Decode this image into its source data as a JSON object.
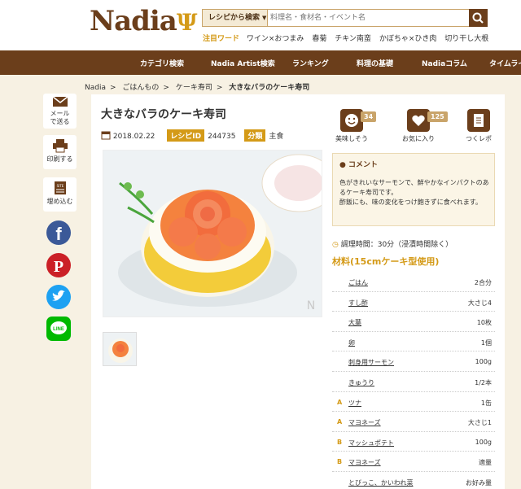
{
  "header": {
    "logo": "Nadia",
    "search_select": "レシピから検索",
    "search_placeholder": "料理名・食材名・イベント名",
    "hot_label": "注目ワード",
    "hot_words": [
      "ワイン×おつまみ",
      "春菊",
      "チキン南蛮",
      "かぼちゃ×ひき肉",
      "切り干し大根"
    ]
  },
  "nav": [
    "カテゴリ検索",
    "Nadia Artist検索",
    "ランキング",
    "料理の基礎",
    "Nadiaコラム",
    "タイムライ"
  ],
  "breadcrumb": [
    "Nadia",
    "ごはんもの",
    "ケーキ寿司",
    "大きなバラのケーキ寿司"
  ],
  "share": {
    "mail": "メール\nで送る",
    "print": "印刷する",
    "embed": "埋め込む",
    "colors": {
      "facebook": "#3b5998",
      "pinterest": "#cb2027",
      "twitter": "#1da1f2",
      "line": "#00b900"
    }
  },
  "recipe": {
    "title": "大きなバラのケーキ寿司",
    "date": "2018.02.22",
    "id_label": "レシピID",
    "id": "244735",
    "category_label": "分類",
    "category": "主食",
    "actions": [
      {
        "label": "美味しそう",
        "count": "34"
      },
      {
        "label": "お気に入り",
        "count": "125"
      },
      {
        "label": "つくレポ",
        "count": ""
      }
    ],
    "comment_title": "コメント",
    "comment": "色がきれいなサーモンで、鮮やかなインパクトのあるケーキ寿司です。\n酢飯にも、味の変化をつけ飽きずに食べれます。",
    "time": "調理時間：30分（浸漬時間除く）",
    "materials_title": "材料(15cmケーキ型使用)",
    "ingredients": [
      {
        "g": "",
        "name": "ごはん",
        "qty": "2合分"
      },
      {
        "g": "",
        "name": "すし酢",
        "qty": "大さじ4"
      },
      {
        "g": "",
        "name": "大葉",
        "qty": "10枚"
      },
      {
        "g": "",
        "name": "卵",
        "qty": "1個"
      },
      {
        "g": "",
        "name": "刺身用サーモン",
        "qty": "100g"
      },
      {
        "g": "",
        "name": "きゅうり",
        "qty": "1/2本"
      },
      {
        "g": "A",
        "name": "ツナ",
        "qty": "1缶"
      },
      {
        "g": "A",
        "name": "マヨネーズ",
        "qty": "大さじ1"
      },
      {
        "g": "B",
        "name": "マッシュポテト",
        "qty": "100g"
      },
      {
        "g": "B",
        "name": "マヨネーズ",
        "qty": "適量"
      },
      {
        "g": "",
        "name": "とびっこ、かいわれ菜",
        "qty": "お好み量"
      }
    ]
  },
  "colors": {
    "brand_brown": "#6b3e1b",
    "accent_gold": "#d49a17",
    "bg": "#f7f1e3"
  }
}
